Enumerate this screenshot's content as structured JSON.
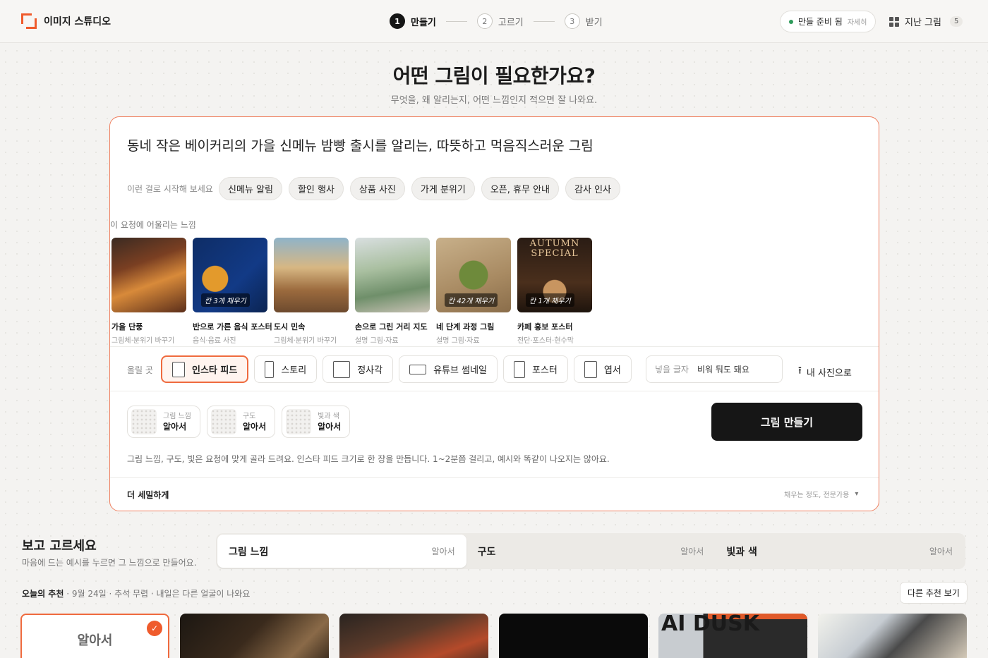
{
  "header": {
    "brand": "이미지 스튜디오",
    "steps": [
      {
        "num": "1",
        "label": "만들기"
      },
      {
        "num": "2",
        "label": "고르기"
      },
      {
        "num": "3",
        "label": "받기"
      }
    ],
    "status": {
      "label": "만들 준비 됨",
      "detail": "자세히"
    },
    "history": {
      "label": "지난 그림",
      "count": "5"
    }
  },
  "hero": {
    "title": "어떤 그림이 필요한가요?",
    "subtitle": "무엇을, 왜 알리는지, 어떤 느낌인지 적으면 잘 나와요."
  },
  "composer": {
    "prompt": "동네 작은 베이커리의 가을 신메뉴 밤빵 출시를 알리는, 따뜻하고 먹음직스러운 그림",
    "starter_label": "이런 걸로 시작해 보세요",
    "starters": [
      "신메뉴 알림",
      "할인 행사",
      "상품 사진",
      "가게 분위기",
      "오픈, 휴무 안내",
      "감사 인사"
    ],
    "mood_label": "이 요청에 어울리는 느낌",
    "moods": [
      {
        "title": "가을 단풍",
        "sub": "그림체·분위기 바꾸기",
        "tag": ""
      },
      {
        "title": "반으로 가른 음식 포스터",
        "sub": "음식·음료 사진",
        "tag": "칸 3개 채우기"
      },
      {
        "title": "도시 민속",
        "sub": "그림체·분위기 바꾸기",
        "tag": ""
      },
      {
        "title": "손으로 그린 거리 지도",
        "sub": "설명 그림·자료",
        "tag": ""
      },
      {
        "title": "네 단계 과정 그림",
        "sub": "설명 그림·자료",
        "tag": "칸 42개 채우기"
      },
      {
        "title": "카페 홍보 포스터",
        "sub": "전단·포스터·현수막",
        "tag": "칸 1개 채우기",
        "overlay": "AUTUMN SPECIAL"
      }
    ],
    "place_label": "올릴 곳",
    "formats": [
      {
        "label": "인스타 피드",
        "active": true
      },
      {
        "label": "스토리",
        "active": false
      },
      {
        "label": "정사각",
        "active": false
      },
      {
        "label": "유튜브 썸네일",
        "active": false
      },
      {
        "label": "포스터",
        "active": false
      },
      {
        "label": "엽서",
        "active": false
      }
    ],
    "text_field": {
      "label": "넣을 글자",
      "value": "비워 둬도 돼요"
    },
    "upload_label": "내 사진으로",
    "options": [
      {
        "caption": "그림 느낌",
        "value": "알아서"
      },
      {
        "caption": "구도",
        "value": "알아서"
      },
      {
        "caption": "빛과 색",
        "value": "알아서"
      }
    ],
    "make_button": "그림 만들기",
    "note": "그림 느낌, 구도, 빛은 요청에 맞게 골라 드려요. 인스타 피드 크기로 한 장을 만듭니다. 1~2분쯤 걸리고, 예시와 똑같이 나오지는 않아요.",
    "detail_label": "더 세밀하게",
    "detail_hint": "채우는 정도, 전문가용"
  },
  "browse": {
    "title": "보고 고르세요",
    "subtitle": "마음에 드는 예시를 누르면 그 느낌으로 만들어요.",
    "tabs": [
      {
        "label": "그림 느낌",
        "value": "알아서"
      },
      {
        "label": "구도",
        "value": "알아서"
      },
      {
        "label": "빛과 색",
        "value": "알아서"
      }
    ],
    "today_bold": "오늘의 추천",
    "today_rest": " · 9월 24일 · 추석 무렵 · 내일은 다른 얼굴이 나와요",
    "more_button": "다른 추천 보기",
    "auto_card": "알아서",
    "poster_text": "AI DUSK"
  },
  "colors": {
    "accent": "#ef5b2c",
    "primary_button": "#161616",
    "ready": "#2f9b5b"
  }
}
